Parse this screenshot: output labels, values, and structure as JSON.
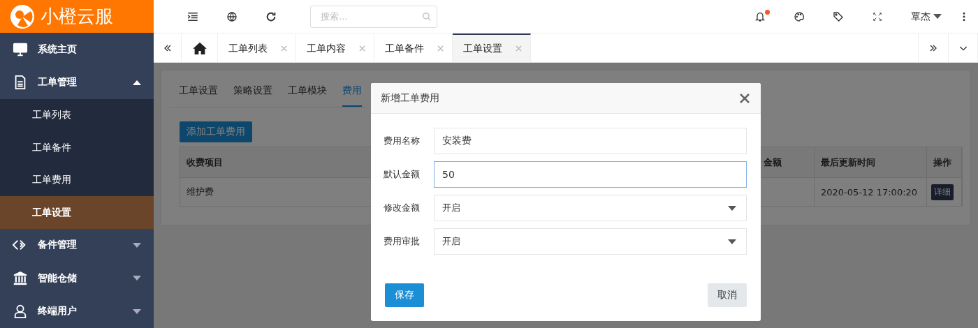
{
  "logo": {
    "text": "小橙云服"
  },
  "toolbar": {
    "search": {
      "placeholder": "搜索..."
    },
    "notification_dot": true,
    "user": "覃杰"
  },
  "sidebar": {
    "items": [
      {
        "label": "系统主页"
      },
      {
        "label": "工单管理",
        "expanded": true,
        "children": [
          {
            "label": "工单列表",
            "selected": false
          },
          {
            "label": "工单备件",
            "selected": false
          },
          {
            "label": "工单费用",
            "selected": false
          },
          {
            "label": "工单设置",
            "selected": true
          }
        ]
      },
      {
        "label": "备件管理",
        "expanded": false
      },
      {
        "label": "智能仓储",
        "expanded": false
      },
      {
        "label": "终端用户",
        "expanded": false
      }
    ]
  },
  "page_tabs": [
    {
      "label": "工单列表",
      "selected": false
    },
    {
      "label": "工单内容",
      "selected": false
    },
    {
      "label": "工单备件",
      "selected": false
    },
    {
      "label": "工单设置",
      "selected": true
    }
  ],
  "settings_tabs": [
    {
      "label": "工单设置",
      "selected": false
    },
    {
      "label": "策略设置",
      "selected": false
    },
    {
      "label": "工单模块",
      "selected": false
    },
    {
      "label": "费用",
      "selected": true
    }
  ],
  "add_button": "添加工单费用",
  "table": {
    "columns": [
      "收费项目",
      "金额",
      "最后更新时间",
      "操作"
    ],
    "rows": [
      {
        "cells": [
          "维护费",
          "",
          "2020-05-12 17:00:20"
        ],
        "action": "详细"
      }
    ]
  },
  "dialog": {
    "title": "新增工单费用",
    "fields": [
      {
        "label": "费用名称",
        "kind": "text",
        "value": "安装费",
        "focused": false
      },
      {
        "label": "默认金额",
        "kind": "text",
        "value": "50",
        "focused": true
      },
      {
        "label": "修改金额",
        "kind": "select",
        "value": "开启",
        "focused": false
      },
      {
        "label": "费用审批",
        "kind": "select",
        "value": "开启",
        "focused": false
      }
    ],
    "save": "保存",
    "cancel": "取消"
  }
}
